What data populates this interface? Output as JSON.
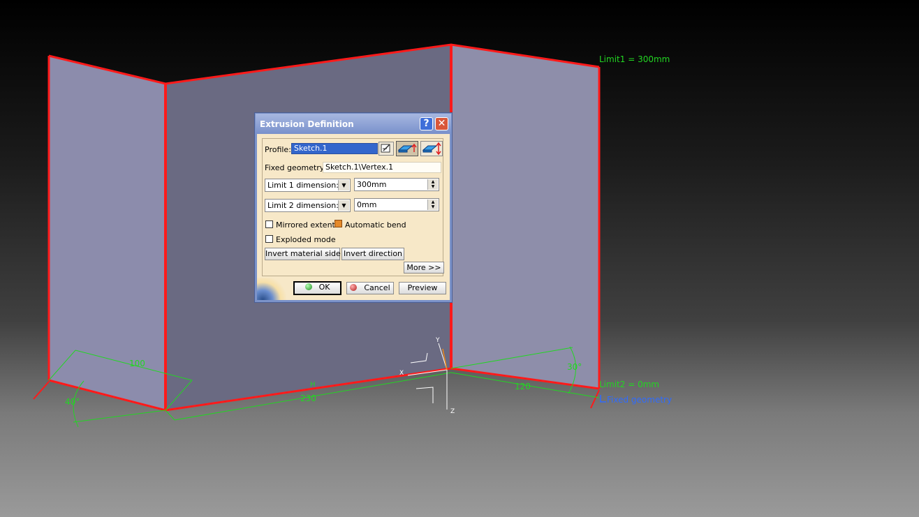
{
  "viewport": {
    "annotations": {
      "limit1": "Limit1 = 300mm",
      "limit2": "Limit2 = 0mm",
      "fixed_geometry": "Fixed geometry"
    },
    "dimensions": {
      "d100": "100",
      "d230": "230",
      "d120": "120",
      "a40": "40°",
      "a30": "30°"
    },
    "axis_labels": {
      "x": "X",
      "y": "Y",
      "z": "Z",
      "h": "H"
    },
    "colors": {
      "edge": "#ff1a1a",
      "dimension": "#22d622",
      "fixed_geometry": "#2f6bff",
      "panel": "#8c8cac"
    }
  },
  "dialog": {
    "title": "Extrusion Definition",
    "help_label": "?",
    "close_label": "✕",
    "profile_label": "Profile:",
    "profile_value": "Sketch.1",
    "fixed_geometry_label": "Fixed geometry:",
    "fixed_geometry_value": "Sketch.1\\Vertex.1",
    "limit1_type": "Limit 1 dimension:",
    "limit1_value": "300mm",
    "limit2_type": "Limit 2 dimension:",
    "limit2_value": "0mm",
    "mirrored_extent": {
      "label": "Mirrored extent",
      "checked": false
    },
    "automatic_bend": {
      "label": "Automatic bend",
      "checked": true
    },
    "exploded_mode": {
      "label": "Exploded mode",
      "checked": false
    },
    "invert_material_label": "Invert material side",
    "invert_direction_label": "Invert direction",
    "more_label": "More >>",
    "ok_label": "OK",
    "cancel_label": "Cancel",
    "preview_label": "Preview",
    "icons": [
      "sketcher-icon",
      "extrude-up-icon",
      "extrude-both-icon"
    ]
  }
}
